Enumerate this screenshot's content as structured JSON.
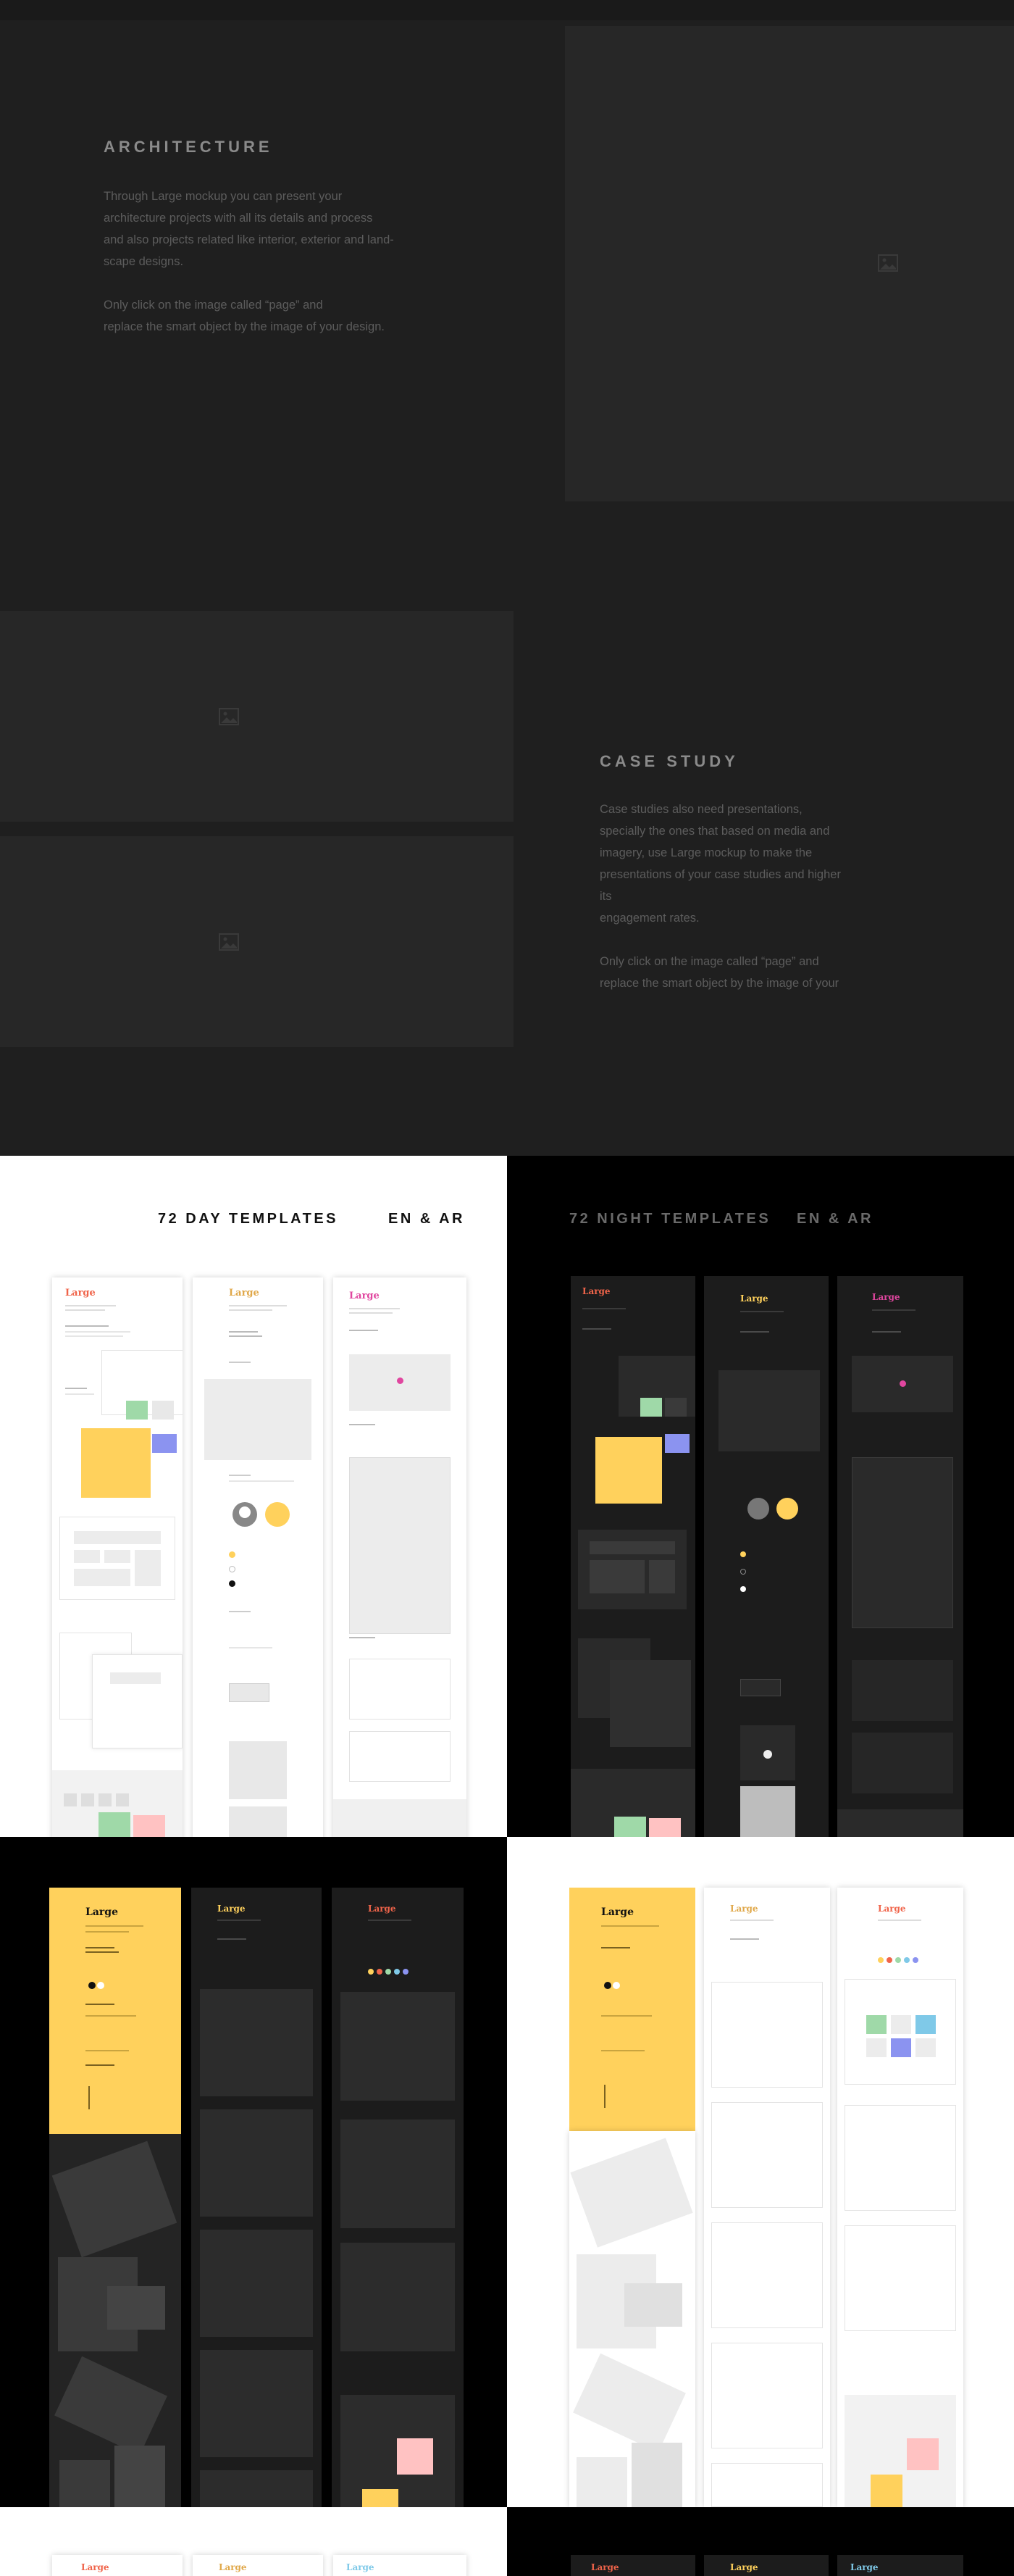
{
  "architecture": {
    "heading": "ARCHITECTURE",
    "paragraph_lines": [
      "Through Large mockup you can present your",
      "architecture projects with all its details and process",
      "and also projects related like interior, exterior and land-",
      "scape designs."
    ],
    "note_lines": [
      "Only click on the image called “page” and",
      "replace the smart object by the image of your design."
    ]
  },
  "case_study": {
    "heading": "CASE STUDY",
    "paragraph_lines": [
      "Case studies also need presentations,",
      "specially the ones that based on media and",
      "imagery, use Large mockup to make the",
      "presentations of your case studies and higher",
      "its",
      "engagement rates."
    ],
    "note_lines": [
      "Only click on the image called “page” and",
      "replace the smart object by the image of your"
    ]
  },
  "templates": {
    "day_label": "72 DAY TEMPLATES",
    "day_lang": "EN & AR",
    "night_label": "72 NIGHT TEMPLATES",
    "night_lang": "EN & AR"
  },
  "page_logo": "Large",
  "colors": {
    "bg_dark": "#1f1f1f",
    "placeholder": "#272727",
    "yellow": "#ffd15c",
    "coral": "#f0644a",
    "pink": "#e0469f",
    "blue": "#8b93f0",
    "green": "#9fd9a8",
    "light_pink": "#ffc2c2",
    "sky": "#7fc9e8"
  },
  "icons": [
    "image-placeholder-icon"
  ]
}
